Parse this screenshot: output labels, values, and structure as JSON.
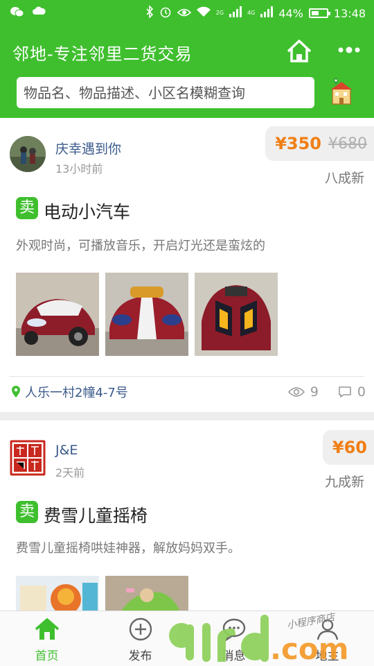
{
  "status_bar": {
    "battery": "44%",
    "time": "13:48",
    "net1": "2G",
    "net2": "4G"
  },
  "app": {
    "title": "邻地-专注邻里二货交易"
  },
  "search": {
    "placeholder": "物品名、物品描述、小区名模糊查询"
  },
  "posts": [
    {
      "user": "庆幸遇到你",
      "time": "13小时前",
      "price": "¥350",
      "original_price": "¥680",
      "condition": "八成新",
      "badge": "卖",
      "title": "电动小汽车",
      "description": "外观时尚，可播放音乐，开启灯光还是蛮炫的",
      "location": "人乐一村2幢4-7号",
      "views": "9",
      "comments": "0"
    },
    {
      "user": "J&E",
      "time": "2天前",
      "price": "¥60",
      "condition": "九成新",
      "badge": "卖",
      "title": "费雪儿童摇椅",
      "description": "费雪儿童摇椅哄娃神器，解放妈妈双手。"
    }
  ],
  "tabs": [
    {
      "label": "首页",
      "icon": "home-icon",
      "active": true
    },
    {
      "label": "发布",
      "icon": "plus-circle-icon"
    },
    {
      "label": "消息",
      "icon": "chat-icon"
    },
    {
      "label": "地主",
      "icon": "user-icon"
    }
  ],
  "watermark": {
    "text": "91rd.com",
    "script": "小程序商店"
  },
  "colors": {
    "brand_green": "#3fbf2e",
    "price_orange": "#f07f15",
    "link_blue": "#3a5a8a"
  }
}
